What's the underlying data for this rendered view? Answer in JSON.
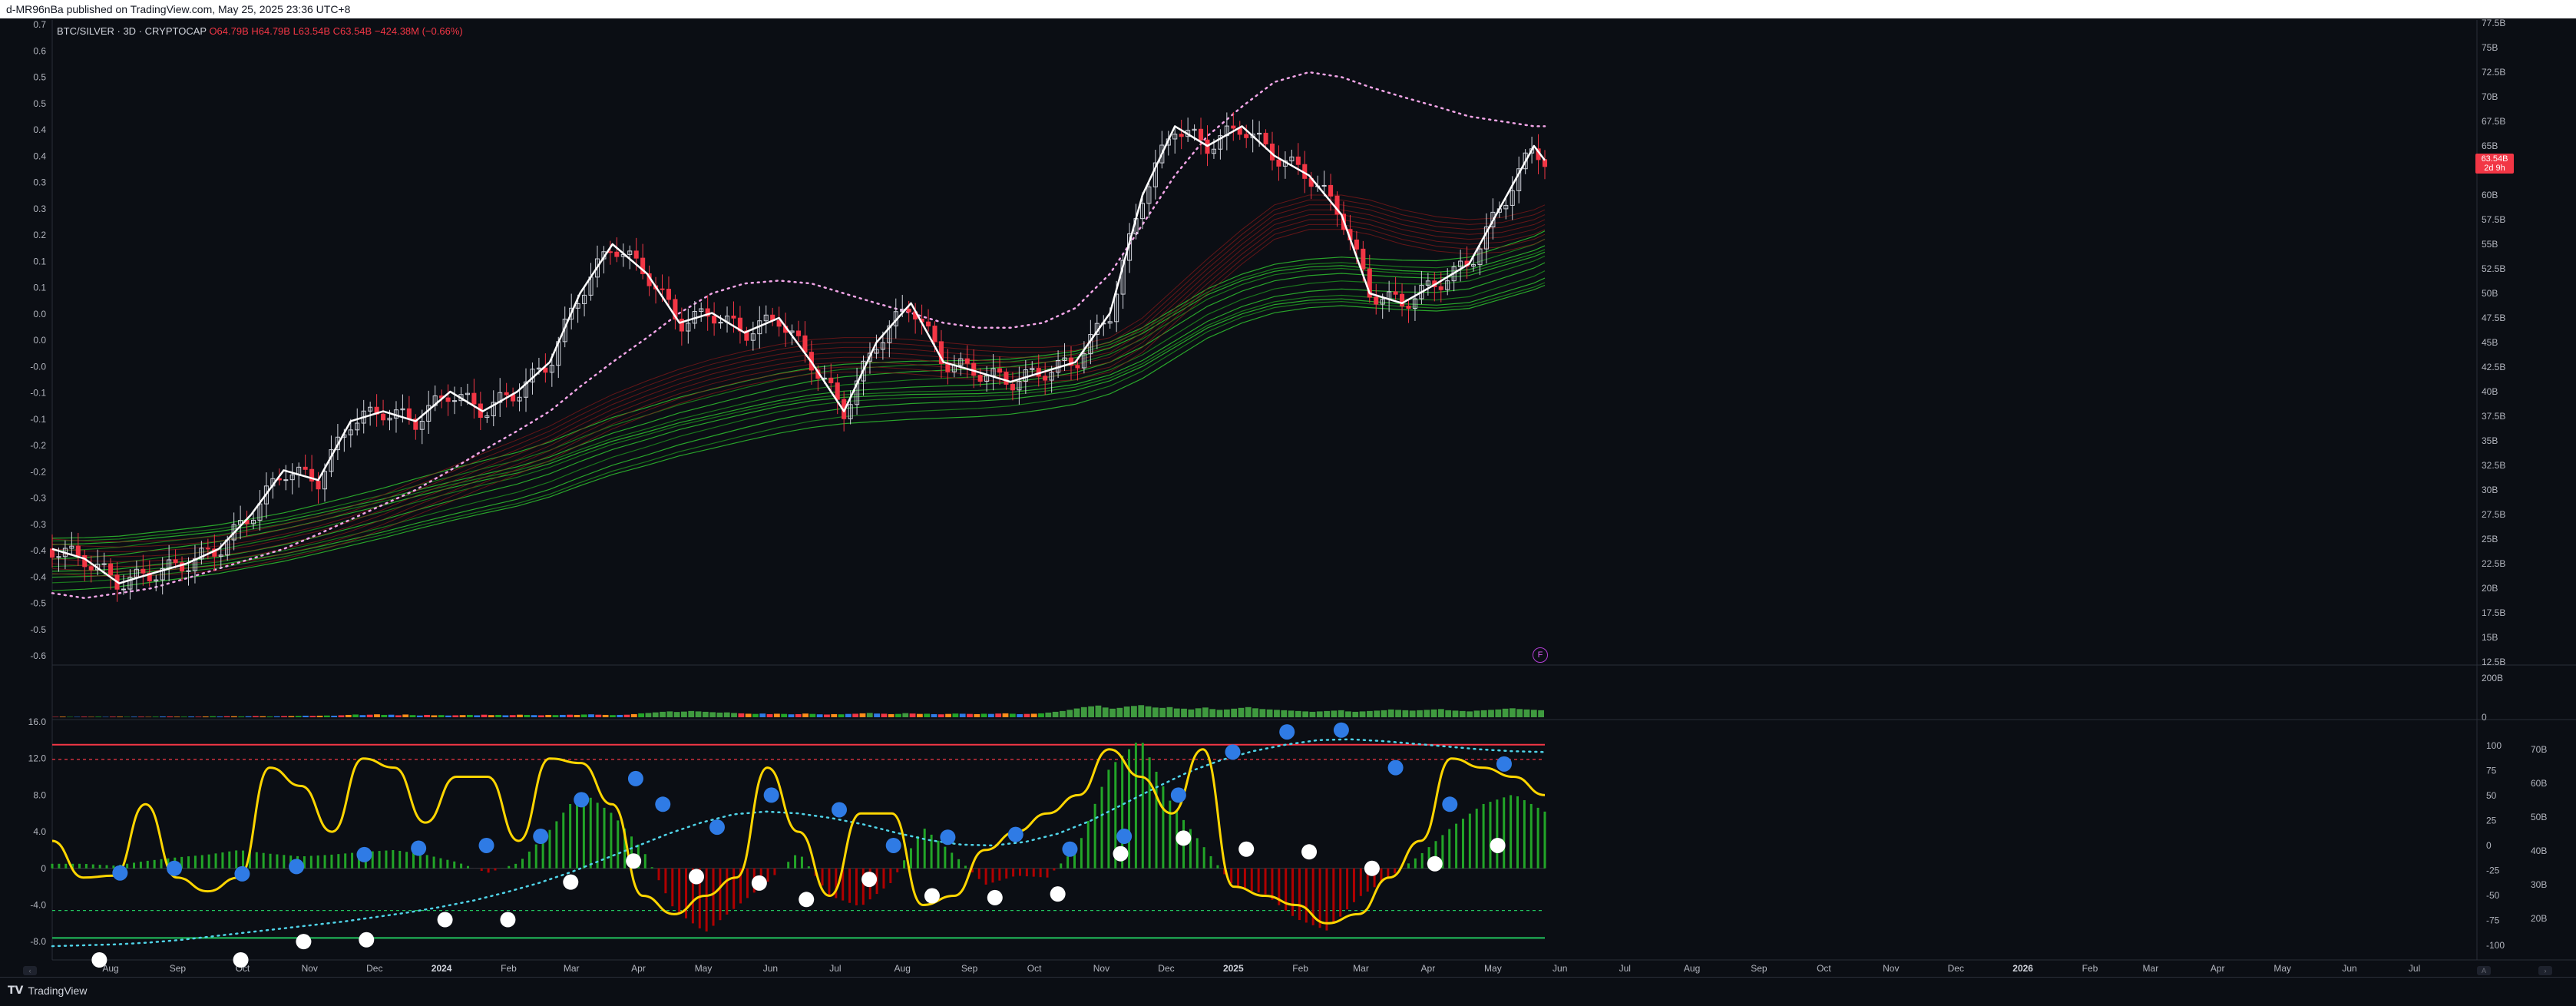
{
  "header": {
    "published": "d-MR96nBa published on TradingView.com, May 25, 2025 23:36 UTC+8"
  },
  "legend": {
    "symbol": "BTC/SILVER · 3D · CRYPTOCAP",
    "values": "O64.79B H64.79B L63.54B C63.54B −424.38M (−0.66%)"
  },
  "price_tag": {
    "price": "63.54B",
    "countdown": "2d 9h"
  },
  "footer": {
    "brand": "TradingView"
  },
  "colors": {
    "background": "#0b0e14",
    "bull": "#089981",
    "bear": "#f23645",
    "line": "#ffffff",
    "osc_line": "#ffd600",
    "hist_up": "#22a528",
    "hist_down": "#b00000",
    "dots_blue": "#2f7be5"
  },
  "chart_data": [
    {
      "type": "line",
      "name": "price-pane",
      "left_axis_ticks": [
        "0.7",
        "0.6",
        "0.5",
        "0.5",
        "0.4",
        "0.4",
        "0.3",
        "0.3",
        "0.2",
        "0.1",
        "0.1",
        "0.0",
        "0.0",
        "-0.0",
        "-0.1",
        "-0.1",
        "-0.2",
        "-0.2",
        "-0.3",
        "-0.3",
        "-0.4",
        "-0.4",
        "-0.5",
        "-0.5",
        "-0.6"
      ],
      "right_axis_ticks": [
        "77.5B",
        "75B",
        "72.5B",
        "70B",
        "67.5B",
        "65B",
        "62.5B",
        "60B",
        "57.5B",
        "55B",
        "52.5B",
        "50B",
        "47.5B",
        "45B",
        "42.5B",
        "40B",
        "37.5B",
        "35B",
        "32.5B",
        "30B",
        "27.5B",
        "25B",
        "22.5B",
        "20B",
        "17.5B",
        "15B",
        "12.5B"
      ],
      "x_ticks": [
        "Aug",
        "Sep",
        "Oct",
        "Nov",
        "Dec",
        "2024",
        "Feb",
        "Mar",
        "Apr",
        "May",
        "Jun",
        "Jul",
        "Aug",
        "Sep",
        "Oct",
        "Nov",
        "Dec",
        "2025",
        "Feb",
        "Mar",
        "Apr",
        "May",
        "Jun",
        "Jul",
        "Aug",
        "Sep",
        "Oct",
        "Nov",
        "Dec",
        "2026",
        "Feb",
        "Mar",
        "Apr",
        "May",
        "Jun",
        "Jul"
      ],
      "x_tick_bold": [
        "2024",
        "2025",
        "2026"
      ],
      "ylim": [
        12.5,
        77.5
      ],
      "x": [
        "2023-07-05",
        "2023-07-20",
        "2023-08-05",
        "2023-08-20",
        "2023-09-05",
        "2023-09-20",
        "2023-10-05",
        "2023-10-20",
        "2023-11-05",
        "2023-11-20",
        "2023-12-05",
        "2023-12-20",
        "2024-01-05",
        "2024-01-20",
        "2024-02-05",
        "2024-02-20",
        "2024-03-05",
        "2024-03-20",
        "2024-04-05",
        "2024-04-20",
        "2024-05-05",
        "2024-05-20",
        "2024-06-05",
        "2024-06-20",
        "2024-07-05",
        "2024-07-20",
        "2024-08-05",
        "2024-08-20",
        "2024-09-05",
        "2024-09-20",
        "2024-10-05",
        "2024-10-20",
        "2024-11-05",
        "2024-11-20",
        "2024-12-05",
        "2024-12-20",
        "2025-01-05",
        "2025-01-20",
        "2025-02-05",
        "2025-02-20",
        "2025-03-05",
        "2025-03-20",
        "2025-04-05",
        "2025-04-20",
        "2025-05-05",
        "2025-05-20",
        "2025-05-25"
      ],
      "close": [
        24,
        23,
        20.5,
        21.5,
        22.5,
        24,
        27.5,
        32,
        31,
        37,
        38,
        37,
        40,
        38,
        40,
        43,
        50,
        55,
        52,
        47,
        48,
        46,
        47.5,
        43,
        38,
        45,
        49,
        43,
        42,
        41,
        42,
        43,
        48,
        60,
        67,
        65,
        67,
        64,
        62,
        58,
        50,
        49,
        51,
        53,
        59,
        65,
        63.54
      ],
      "series": [
        {
          "name": "",
          "values": [
            19.5,
            19,
            19.5,
            20,
            21,
            22,
            23,
            24,
            25.5,
            27,
            28.5,
            30,
            32,
            34,
            36,
            38,
            40.5,
            43,
            45.5,
            48,
            50,
            51,
            51.3,
            51,
            50,
            49,
            48,
            47,
            46.5,
            46.5,
            47,
            48.5,
            52,
            57,
            62,
            66,
            69,
            71.5,
            72.5,
            72,
            71,
            70,
            69,
            68,
            67.5,
            67,
            67
          ]
        }
      ],
      "ribbon_green_base": [
        22.5,
        22.6,
        22.8,
        23.2,
        23.6,
        24,
        24.6,
        25.2,
        26,
        26.8,
        27.6,
        28.5,
        29.4,
        30.2,
        31,
        32,
        33.2,
        34.4,
        35.4,
        36.4,
        37.2,
        38,
        38.8,
        39.4,
        39.8,
        40,
        40.2,
        40.3,
        40.4,
        40.6,
        41,
        41.5,
        42.5,
        44,
        46,
        48,
        49.5,
        50.5,
        51,
        51.2,
        51,
        50.8,
        50.7,
        51,
        52,
        53,
        53.5
      ],
      "ribbon_red_base": [
        23.5,
        23.3,
        23.2,
        23.3,
        23.5,
        23.8,
        24.3,
        25,
        25.8,
        26.8,
        28,
        29.4,
        30.8,
        32.2,
        33.6,
        35,
        36.6,
        38.2,
        39.6,
        40.8,
        41.8,
        42.6,
        43.3,
        43.8,
        44,
        44,
        43.8,
        43.5,
        43.2,
        43,
        43,
        43.2,
        44,
        46,
        49,
        52,
        55,
        57.5,
        58.5,
        58.5,
        58,
        57,
        56.3,
        56,
        56.2,
        57,
        57.5
      ]
    },
    {
      "type": "bar",
      "name": "volume-pane",
      "right_axis_ticks": [
        "200B",
        "0"
      ],
      "values": [
        2,
        3,
        2,
        2,
        3,
        2,
        3,
        2,
        3,
        3,
        2,
        3,
        3,
        2,
        3,
        4,
        4,
        3,
        3,
        4,
        3,
        4,
        5,
        4,
        5,
        5,
        4,
        5,
        6,
        5,
        4,
        5,
        6,
        6,
        7,
        8,
        7,
        8,
        9,
        8,
        10,
        12,
        14,
        11,
        13,
        15,
        12,
        13,
        10,
        14,
        11,
        9,
        12,
        10,
        11,
        9,
        10,
        11,
        12,
        10,
        13,
        11,
        12,
        10,
        11,
        13,
        12,
        11,
        10,
        12,
        11,
        12,
        13,
        12,
        14,
        15,
        13,
        12,
        11,
        12,
        13,
        16,
        20,
        22,
        25,
        28,
        30,
        27,
        29,
        32,
        30,
        28,
        26,
        24,
        25,
        22,
        20,
        18,
        17,
        19,
        16,
        18,
        17,
        15,
        16,
        19,
        17,
        15,
        14,
        16,
        15,
        17,
        18,
        20,
        22,
        19,
        18,
        16,
        17,
        21,
        19,
        17,
        18,
        16,
        15,
        17,
        19,
        18,
        17,
        16,
        18,
        17,
        19,
        20,
        18,
        16,
        17,
        18,
        20,
        24,
        28,
        32,
        38,
        45,
        52,
        56,
        60,
        50,
        44,
        48,
        55,
        58,
        62,
        56,
        50,
        48,
        52,
        45,
        44,
        40,
        46,
        50,
        42,
        38,
        40,
        44,
        48,
        52,
        46,
        42,
        40,
        38,
        36,
        34,
        32,
        30,
        28,
        30,
        32,
        34,
        36,
        30,
        28,
        30,
        32,
        34,
        36,
        40,
        38,
        36,
        34,
        36,
        38,
        40,
        42,
        36,
        34,
        32,
        30,
        34,
        36,
        38,
        40,
        44,
        46,
        42,
        40,
        38,
        36
      ],
      "ylim": [
        0,
        260
      ]
    },
    {
      "type": "line",
      "name": "oscillator-pane",
      "left_axis_ticks": [
        "16.0",
        "12.0",
        "8.0",
        "4.0",
        "0",
        "-4.0",
        "-8.0"
      ],
      "right_axis_ticks": [
        "100",
        "75",
        "50",
        "25",
        "0",
        "-25",
        "-50",
        "-75",
        "-100"
      ],
      "right_axis_ticks_2": [
        "70B",
        "60B",
        "50B",
        "40B",
        "30B",
        "20B"
      ],
      "ylim": [
        -10,
        16
      ],
      "levels": [
        13.5,
        11.9,
        0,
        -4.6,
        -7.6
      ],
      "series": [
        {
          "name": "",
          "values": [
            3,
            -1,
            -0.8,
            7,
            -1,
            -2.5,
            -1,
            11,
            9,
            4,
            12,
            11,
            5,
            10,
            10,
            3,
            12,
            11.5,
            7,
            -3,
            -5,
            -3,
            -1,
            11,
            4,
            -3,
            6,
            6,
            -4,
            -3,
            2,
            4,
            6,
            8,
            13,
            10,
            6,
            13,
            -2,
            -3,
            -4,
            -6,
            -5,
            -1,
            3,
            12,
            11,
            10,
            8
          ]
        },
        {
          "name": "",
          "values": [
            -8.5,
            -8.4,
            -8.3,
            -8.1,
            -7.8,
            -7.4,
            -7,
            -6.6,
            -6.2,
            -5.8,
            -5.3,
            -4.8,
            -4.2,
            -3.5,
            -2.6,
            -1.6,
            -0.4,
            1,
            2.4,
            3.8,
            5,
            5.9,
            6.2,
            6,
            5.5,
            4.8,
            3.9,
            3.1,
            2.6,
            2.5,
            2.9,
            3.8,
            5.2,
            7,
            8.8,
            10.5,
            11.8,
            12.8,
            13.5,
            14,
            14.1,
            13.9,
            13.6,
            13.3,
            13,
            12.8,
            12.7
          ]
        },
        {
          "name": "",
          "values": [
            0.5,
            0.5,
            0.3,
            0.8,
            1.2,
            1.5,
            2,
            1.6,
            1.3,
            1.5,
            1.8,
            2,
            1.5,
            0.7,
            -0.5,
            0.6,
            4.2,
            8.5,
            6,
            2,
            -4.5,
            -7,
            -4.2,
            -1.5,
            1.8,
            -3,
            -4.2,
            -1.5,
            4.5,
            1.5,
            -1.8,
            -0.8,
            -1,
            2.5,
            11,
            14.2,
            7,
            2.5,
            -2,
            -2.8,
            -5.5,
            -6.8,
            -3.2,
            -1,
            1.5,
            4.5,
            7,
            8.1,
            6.2
          ]
        }
      ],
      "blue_dots": [
        [
          0.05,
          -0.5
        ],
        [
          0.09,
          0
        ],
        [
          0.14,
          -0.6
        ],
        [
          0.18,
          0.2
        ],
        [
          0.23,
          1.5
        ],
        [
          0.27,
          2.2
        ],
        [
          0.32,
          2.5
        ],
        [
          0.36,
          3.5
        ],
        [
          0.39,
          7.5
        ],
        [
          0.43,
          9.8
        ],
        [
          0.45,
          7
        ],
        [
          0.49,
          4.5
        ],
        [
          0.53,
          8
        ],
        [
          0.58,
          6.4
        ],
        [
          0.62,
          2.5
        ],
        [
          0.66,
          3.4
        ],
        [
          0.71,
          3.7
        ],
        [
          0.75,
          2.1
        ],
        [
          0.79,
          3.5
        ],
        [
          0.83,
          8
        ],
        [
          0.87,
          12.7
        ],
        [
          0.91,
          14.9
        ],
        [
          0.95,
          15.1
        ],
        [
          0.99,
          11
        ],
        [
          1.03,
          7
        ],
        [
          1.07,
          11.4
        ]
      ],
      "white_dots": [
        [
          0.03,
          -10
        ],
        [
          0.12,
          -10
        ],
        [
          0.16,
          -8
        ],
        [
          0.2,
          -7.8
        ],
        [
          0.25,
          -5.6
        ],
        [
          0.29,
          -5.6
        ],
        [
          0.33,
          -1.5
        ],
        [
          0.37,
          0.8
        ],
        [
          0.41,
          -0.9
        ],
        [
          0.45,
          -1.6
        ],
        [
          0.48,
          -3.4
        ],
        [
          0.52,
          -1.2
        ],
        [
          0.56,
          -3
        ],
        [
          0.6,
          -3.2
        ],
        [
          0.64,
          -2.8
        ],
        [
          0.68,
          1.6
        ],
        [
          0.72,
          3.3
        ],
        [
          0.76,
          2.1
        ],
        [
          0.8,
          1.8
        ],
        [
          0.84,
          0
        ],
        [
          0.88,
          0.5
        ],
        [
          0.92,
          2.5
        ]
      ]
    }
  ]
}
